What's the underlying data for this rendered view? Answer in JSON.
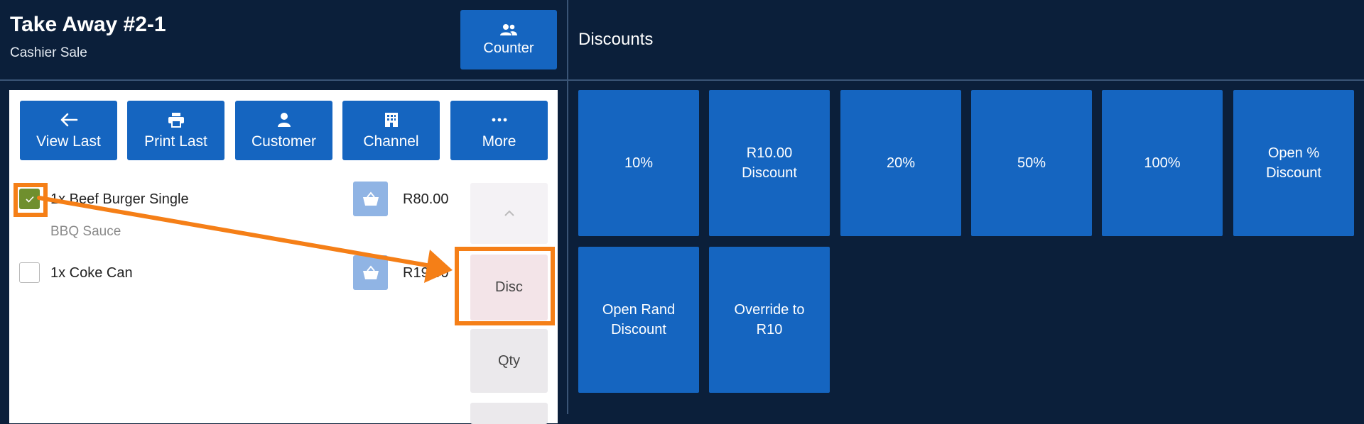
{
  "header": {
    "title": "Take Away #2-1",
    "subtitle": "Cashier Sale",
    "counter_label": "Counter"
  },
  "discounts_panel": {
    "title": "Discounts",
    "buttons": [
      {
        "label": "10%"
      },
      {
        "label": "R10.00\nDiscount"
      },
      {
        "label": "20%"
      },
      {
        "label": "50%"
      },
      {
        "label": "100%"
      },
      {
        "label": "Open %\nDiscount"
      },
      {
        "label": "Open Rand\nDiscount"
      },
      {
        "label": "Override to\nR10"
      }
    ]
  },
  "toolbar": {
    "view_last": "View Last",
    "print_last": "Print Last",
    "customer": "Customer",
    "channel": "Channel",
    "more": "More"
  },
  "order_items": [
    {
      "name": "1x Beef Burger Single",
      "modifier": "BBQ Sauce",
      "price": "R80.00",
      "checked": true
    },
    {
      "name": "1x Coke Can",
      "price": "R19.00",
      "checked": false
    }
  ],
  "side_actions": {
    "disc": "Disc",
    "qty": "Qty"
  },
  "colors": {
    "background": "#0b1f3a",
    "button_blue": "#1565c0",
    "highlight_orange": "#f57f17",
    "checkbox_green": "#6f8f2e"
  },
  "icons": [
    "people-icon",
    "arrow-left-icon",
    "printer-icon",
    "person-icon",
    "building-icon",
    "dots-icon",
    "check-icon",
    "basket-icon",
    "chevron-up-icon"
  ]
}
